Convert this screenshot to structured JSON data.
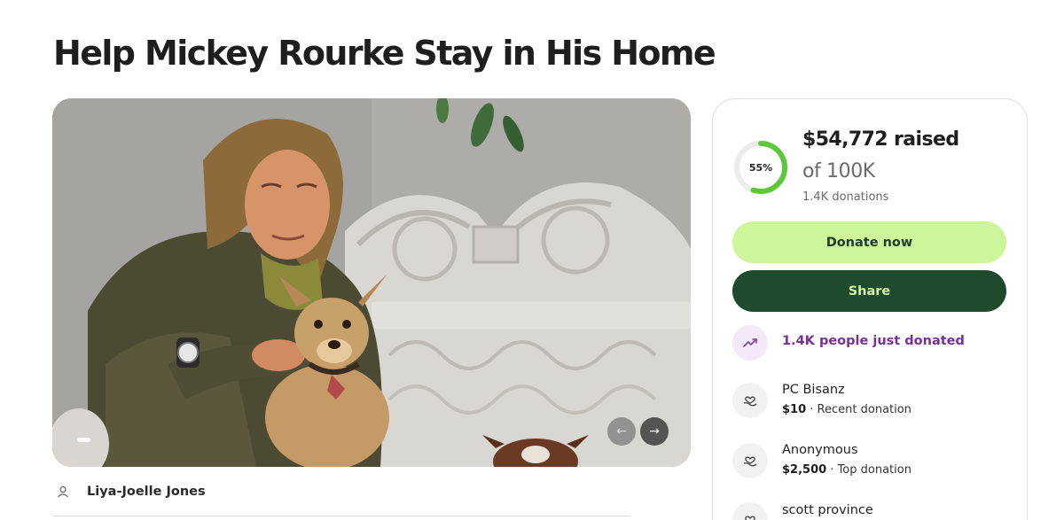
{
  "campaign": {
    "title": "Help Mickey Rourke Stay in His Home"
  },
  "hero": {
    "prev_glyph": "←",
    "next_glyph": "→"
  },
  "organizer": {
    "name": "Liya-Joelle Jones",
    "icon": "person-icon"
  },
  "progress": {
    "percent_label": "55%",
    "fraction": 0.55,
    "raised_text": "$54,772 raised",
    "goal_text": "of 100K",
    "donations_text": "1.4K donations"
  },
  "actions": {
    "donate_label": "Donate now",
    "share_label": "Share"
  },
  "activity": {
    "trend_text": "1.4K people just donated",
    "icon": "trending-up-icon"
  },
  "donations": [
    {
      "name": "PC Bisanz",
      "amount": "$10",
      "note": "Recent donation",
      "icon": "heart-hand-icon"
    },
    {
      "name": "Anonymous",
      "amount": "$2,500",
      "note": "Top donation",
      "icon": "heart-hand-icon"
    },
    {
      "name": "scott province",
      "icon": "heart-hand-icon"
    }
  ],
  "colors": {
    "donate_bg": "#cdf59a",
    "share_bg": "#1f4a2c",
    "progress_green": "#5cc93a",
    "trend_purple": "#7a2f95"
  }
}
